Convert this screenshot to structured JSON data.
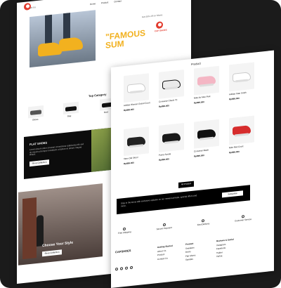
{
  "header": {
    "contact_label": "Contact Us",
    "nav": [
      "Home",
      "Product",
      "Contact"
    ],
    "promo_text": "Get 30% off on Shoes"
  },
  "hero": {
    "headline_line1": "\"FAMOUS",
    "headline_line2": "SUM",
    "brand_tag": "CAP SHOES"
  },
  "top_category": {
    "title": "Top Category",
    "items": [
      "Shoes",
      "Bag",
      "Boot",
      "Sneakers"
    ]
  },
  "flat_shoes": {
    "title": "FLAT SHOES",
    "desc": "Lorem ipsum dolor sit amet consectetur adipiscing elit sed do eiusmod tempor incididunt ut labore et dolore magna aliqua.",
    "button": "Shop Collection"
  },
  "promo_banner": {
    "headline": "Choose Your Style",
    "button": "Shop Collection"
  },
  "product": {
    "title": "Product",
    "items": [
      {
        "name": "Adidas Women Grand Court",
        "price": "Rp899.000",
        "color": "#ffffff"
      },
      {
        "name": "Converse Chuck 70",
        "price": "Rp899.000",
        "color": "#eaeaea"
      },
      {
        "name": "Nike Air Max Pink",
        "price": "Rp899.000",
        "color": "#f4b6c4"
      },
      {
        "name": "Adidas Stan Smith",
        "price": "Rp899.000",
        "color": "#ffffff"
      },
      {
        "name": "Vans Old Skool",
        "price": "Rp899.000",
        "color": "#222222"
      },
      {
        "name": "Puma Suede",
        "price": "Rp899.000",
        "color": "#1a1a1a"
      },
      {
        "name": "Converse Black",
        "price": "Rp899.000",
        "color": "#101010"
      },
      {
        "name": "Nike Red Court",
        "price": "Rp899.000",
        "color": "#d62c2c"
      }
    ],
    "all_button": "All Product"
  },
  "newsletter": {
    "text": "Stay in the know with exclusive updates on our newest arrivals, special offers and more.",
    "button": "Subscribe"
  },
  "features": [
    "Free Shipping",
    "Secure Payment",
    "Fast Delivery",
    "Customer Service"
  ],
  "footer": {
    "brand": "CAPSHOES",
    "cols": [
      {
        "title": "Getting Started",
        "links": [
          "About Us",
          "Product",
          "Contact Us"
        ]
      },
      {
        "title": "Product",
        "links": [
          "Sneakers",
          "Boots",
          "Flat Shoes",
          "Sandals"
        ]
      },
      {
        "title": "Reviews & Social",
        "links": [
          "Instagram",
          "Facebook",
          "Twitter",
          "TikTok"
        ]
      }
    ]
  }
}
